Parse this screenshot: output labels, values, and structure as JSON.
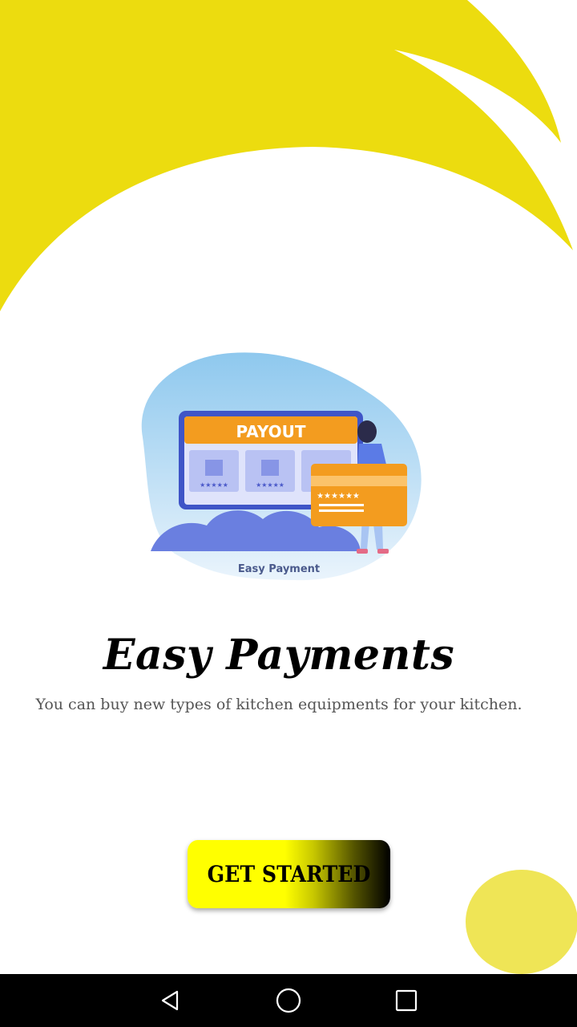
{
  "onboarding": {
    "illustration_banner": "PAYOUT",
    "illustration_caption": "Easy Payment",
    "title": "Easy Payments",
    "description": "You can buy new types of kitchen equipments for your kitchen.",
    "get_started_label": "GET STARTED"
  },
  "colors": {
    "accent_yellow": "#ecdc0f",
    "circle_yellow": "#efe556",
    "button_gradient_start": "#ffff00",
    "button_gradient_end": "#000000",
    "nav_bar": "#000000"
  },
  "navigation_bar": {
    "buttons": [
      "back-icon",
      "home-icon",
      "recent-apps-icon"
    ]
  }
}
